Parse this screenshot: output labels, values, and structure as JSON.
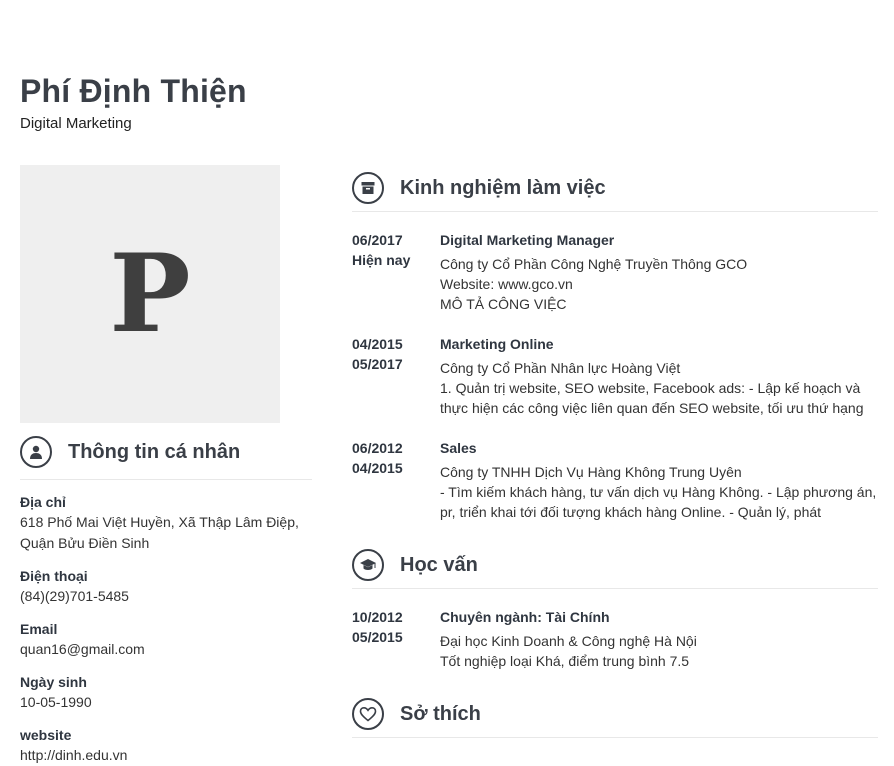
{
  "profile": {
    "name": "Phí Định Thiện",
    "title": "Digital Marketing",
    "avatar_letter": "P"
  },
  "personal": {
    "heading": "Thông tin cá nhân",
    "icon": "user-icon",
    "fields": [
      {
        "label": "Địa chỉ",
        "value": "618 Phố Mai Việt Huyền, Xã Thập Lâm Điệp, Quận Bửu Điền Sinh"
      },
      {
        "label": "Điện thoại",
        "value": "(84)(29)701-5485"
      },
      {
        "label": "Email",
        "value": "quan16@gmail.com"
      },
      {
        "label": "Ngày sinh",
        "value": "10-05-1990"
      },
      {
        "label": "website",
        "value": "http://dinh.edu.vn"
      }
    ]
  },
  "experience": {
    "heading": "Kinh nghiệm làm việc",
    "icon": "archive-box-icon",
    "items": [
      {
        "start": "06/2017",
        "end": "Hiện nay",
        "title": "Digital Marketing Manager",
        "line1": "Công ty Cổ Phần Công Nghệ Truyền Thông GCO",
        "line2": "Website: www.gco.vn",
        "line3": "MÔ TẢ CÔNG VIỆC"
      },
      {
        "start": "04/2015",
        "end": "05/2017",
        "title": "Marketing Online",
        "line1": "Công ty Cổ Phần Nhân lực Hoàng Việt",
        "desc": "1. Quản trị website, SEO website, Facebook ads:   - Lập kế hoạch và thực hiện các công việc liên quan đến SEO website, tối ưu thứ hạng"
      },
      {
        "start": "06/2012",
        "end": "04/2015",
        "title": "Sales",
        "line1": "Công ty TNHH Dịch Vụ Hàng Không Trung Uyên",
        "desc": "- Tìm kiếm khách hàng, tư vấn dịch vụ Hàng Không. - Lập phương án, pr, triển khai tới đối tượng khách hàng Online. - Quản lý, phát"
      }
    ]
  },
  "education": {
    "heading": "Học vấn",
    "icon": "graduation-cap-icon",
    "items": [
      {
        "start": "10/2012",
        "end": "05/2015",
        "title": "Chuyên ngành: Tài Chính",
        "line1": "Đại học Kinh Doanh & Công nghệ Hà Nội",
        "line2": "Tốt nghiệp loại Khá, điểm trung bình 7.5"
      }
    ]
  },
  "hobbies": {
    "heading": "Sở thích",
    "icon": "heart-icon"
  }
}
